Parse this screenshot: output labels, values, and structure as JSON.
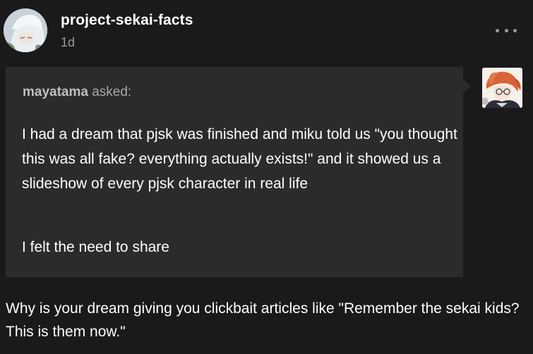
{
  "post": {
    "blog_name": "project-sekai-facts",
    "timestamp": "1d",
    "menu_icon": "more-horizontal-icon"
  },
  "ask": {
    "asker_name": "mayatama",
    "asked_label": " asked:",
    "paragraphs": [
      "I had a dream that pjsk was finished and miku told us \"you thought this was all fake? everything actually exists!\" and it showed us a slideshow of every pjsk character in real life",
      "I felt the need to share"
    ]
  },
  "answer": {
    "text": "Why is your dream giving you clickbait articles like \"Remember the sekai kids? This is them now.\""
  },
  "colors": {
    "background": "#1a1a1a",
    "ask_box": "#2b2b2b",
    "muted_text": "#9a9a9a"
  }
}
